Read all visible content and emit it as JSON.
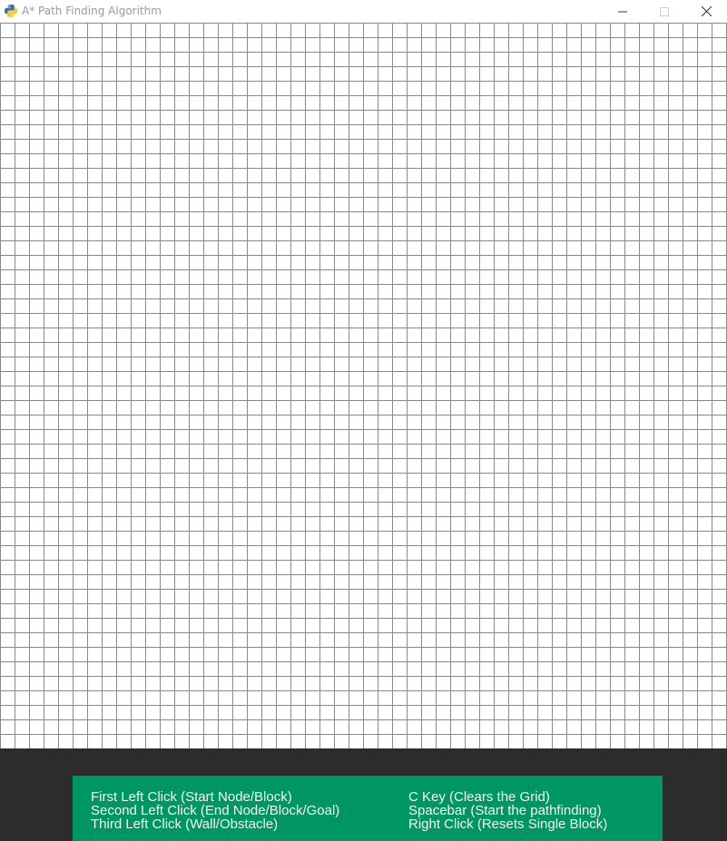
{
  "window": {
    "title": "A* Path Finding Algorithm",
    "icon": "python-icon",
    "controls": [
      "minimize-icon",
      "maximize-icon",
      "close-icon"
    ]
  },
  "grid": {
    "rows": 50,
    "columns": 50,
    "line_color": "#8a8a8a",
    "cell_color": "#ffffff"
  },
  "instructions": {
    "left": [
      "First Left Click (Start Node/Block)",
      "Second Left Click (End Node/Block/Goal)",
      "Third Left Click (Wall/Obstacle)"
    ],
    "right": [
      "C Key (Clears the Grid)",
      "Spacebar (Start the pathfinding)",
      "Right Click (Resets Single Block)"
    ]
  },
  "colors": {
    "panel_background": "#2c2c2c",
    "legend_background": "#009663",
    "legend_text": "#f2f2f2",
    "title_text": "#9a9a9a"
  }
}
